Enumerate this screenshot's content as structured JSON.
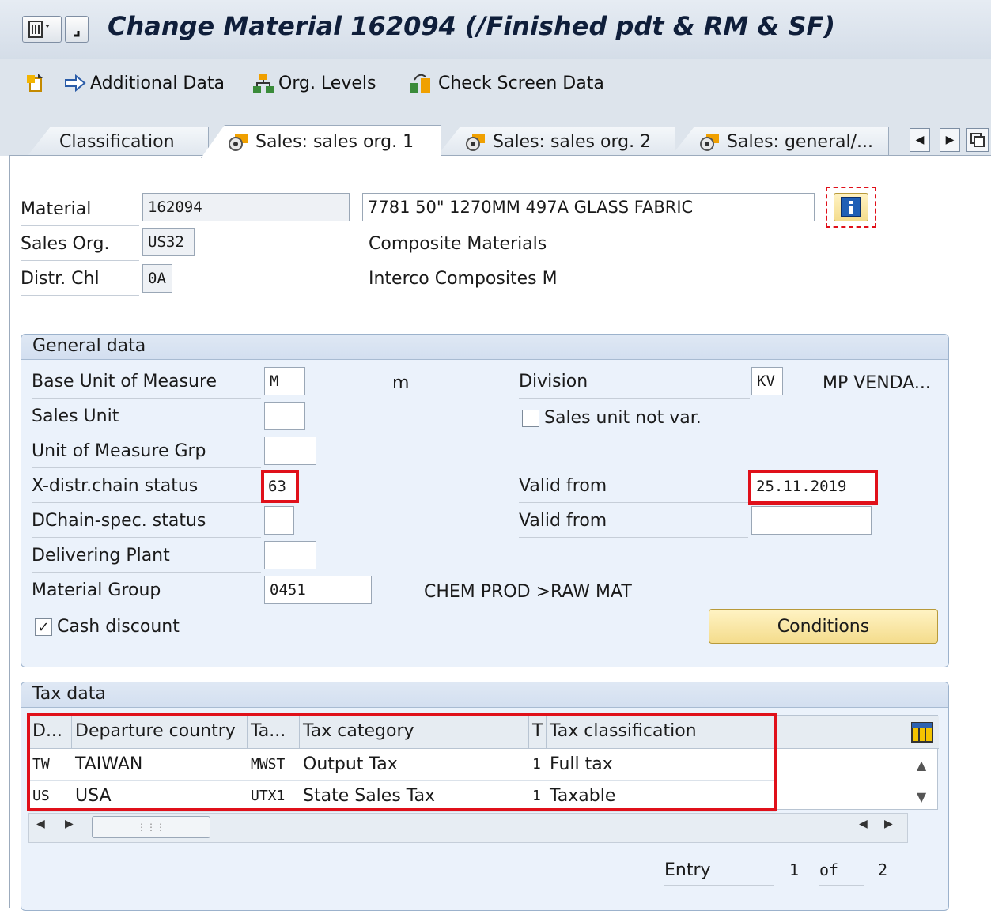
{
  "window": {
    "title": "Change Material 162094 (/Finished pdt & RM & SF)"
  },
  "toolbar": {
    "additional_data": "Additional Data",
    "org_levels": "Org. Levels",
    "check_screen_data": "Check Screen Data"
  },
  "tabs": [
    {
      "label": "Classification"
    },
    {
      "label": "Sales: sales org. 1"
    },
    {
      "label": "Sales: sales org. 2"
    },
    {
      "label": "Sales: general/..."
    }
  ],
  "header": {
    "material_label": "Material",
    "material_value": "162094",
    "material_desc": "7781 50\" 1270MM 497A GLASS FABRIC",
    "sales_org_label": "Sales Org.",
    "sales_org_value": "US32",
    "sales_org_desc": "Composite Materials",
    "distr_chl_label": "Distr. Chl",
    "distr_chl_value": "0A",
    "distr_chl_desc": "Interco Composites M"
  },
  "general": {
    "title": "General data",
    "base_uom_label": "Base Unit of Measure",
    "base_uom_value": "M",
    "base_uom_text": "m",
    "division_label": "Division",
    "division_value": "KV",
    "division_text": "MP VENDA...",
    "sales_unit_label": "Sales Unit",
    "sales_unit_value": "",
    "sales_unit_not_var_label": "Sales unit not var.",
    "uom_grp_label": "Unit of Measure Grp",
    "uom_grp_value": "",
    "xdistr_label": "X-distr.chain status",
    "xdistr_value": "63",
    "valid_from_label": "Valid from",
    "valid_from_value": "25.11.2019",
    "dchain_label": "DChain-spec. status",
    "dchain_value": "",
    "valid_from2_label": "Valid from",
    "valid_from2_value": "",
    "delivering_plant_label": "Delivering Plant",
    "delivering_plant_value": "",
    "material_group_label": "Material Group",
    "material_group_value": "0451",
    "material_group_text": "CHEM PROD >RAW MAT",
    "cash_discount_label": "Cash discount",
    "conditions_button": "Conditions"
  },
  "tax": {
    "title": "Tax data",
    "columns": [
      "D...",
      "Departure country",
      "Ta...",
      "Tax category",
      "T",
      "Tax classification"
    ],
    "rows": [
      [
        "TW",
        "TAIWAN",
        "MWST",
        "Output Tax",
        "1",
        "Full tax"
      ],
      [
        "US",
        "USA",
        "UTX1",
        "State Sales Tax",
        "1",
        "Taxable"
      ]
    ],
    "entry_label": "Entry",
    "entry_current": "1",
    "entry_of": "of",
    "entry_total": "2"
  }
}
